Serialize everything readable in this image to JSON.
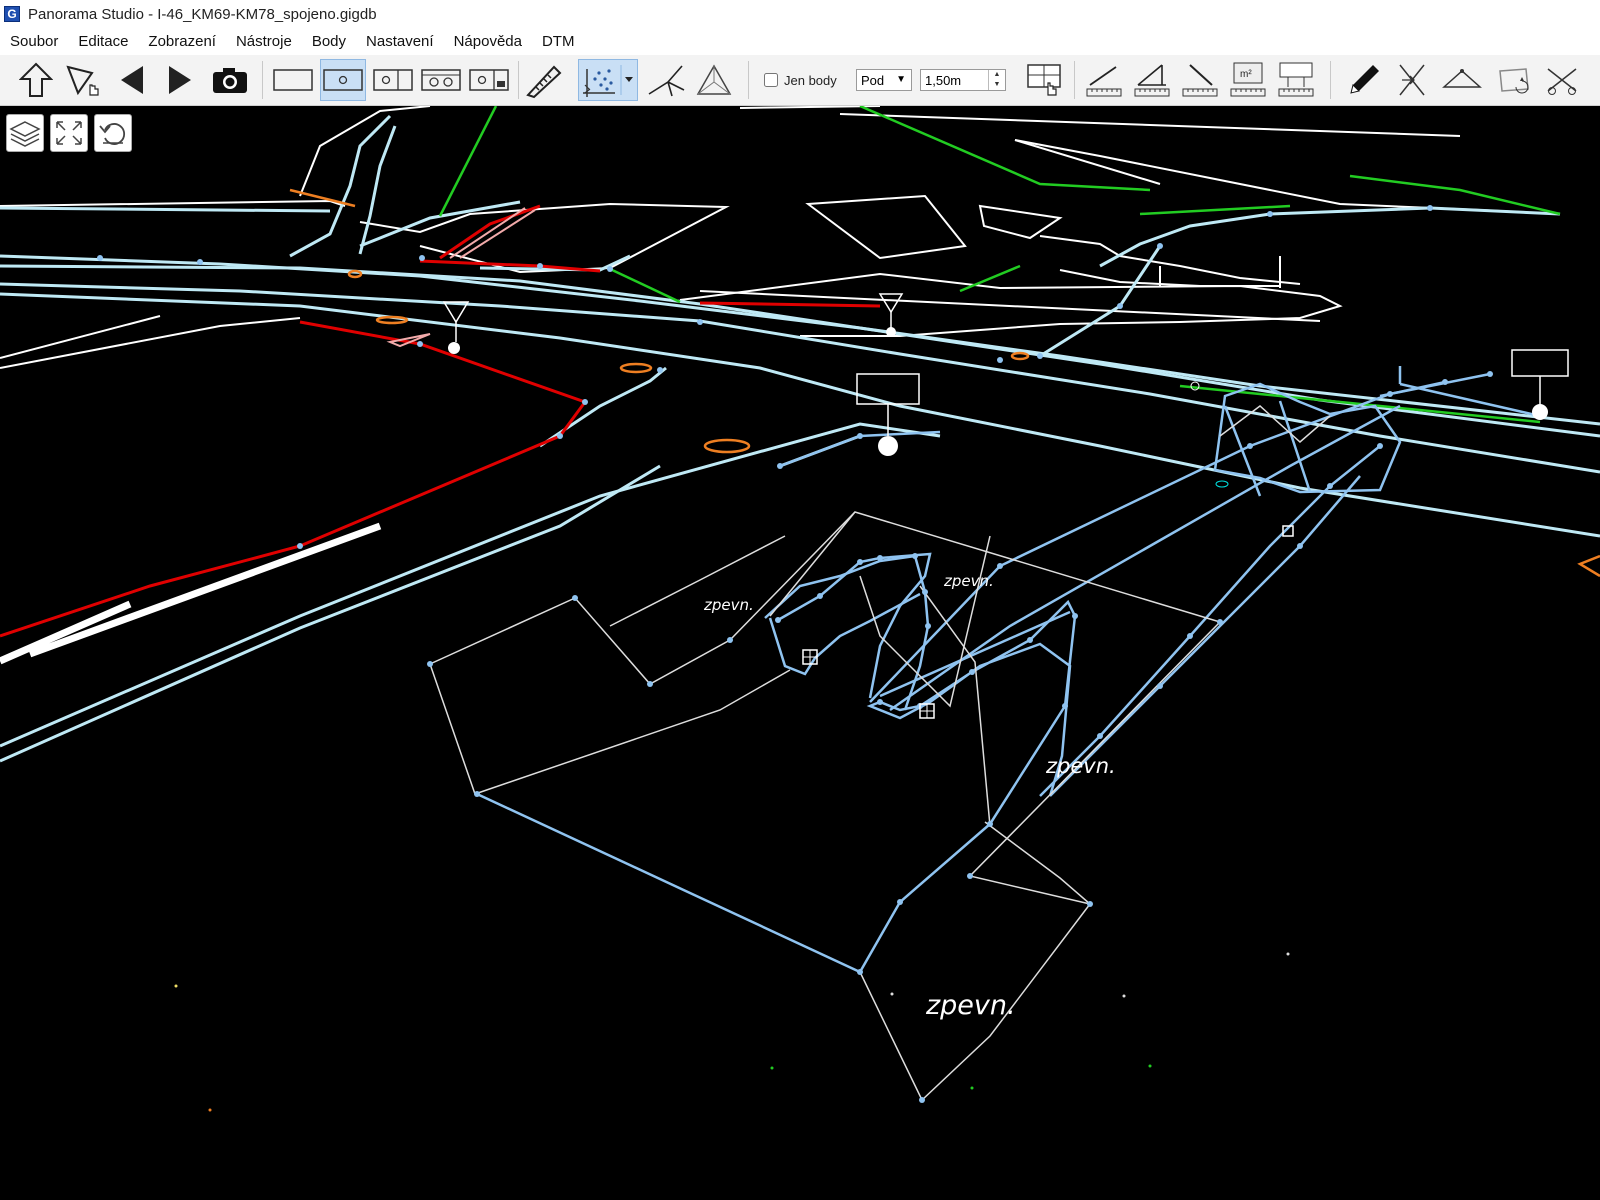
{
  "window": {
    "title": "Panorama Studio - I-46_KM69-KM78_spojeno.gigdb",
    "app_icon_letter": "G"
  },
  "menu": [
    "Soubor",
    "Editace",
    "Zobrazení",
    "Nástroje",
    "Body",
    "Nastavení",
    "Nápověda",
    "DTM"
  ],
  "toolbar": {
    "only_points_label": "Jen body",
    "only_points_checked": false,
    "position_select": "Pod",
    "height_value": "1,50m",
    "icons": [
      "arrow-up-icon",
      "select-cursor-icon",
      "previous-icon",
      "next-icon",
      "camera-icon",
      "rect-single-icon",
      "rect-circle-icon",
      "rect-circle-split-icon",
      "rect-double-circle-icon",
      "rect-text-icon",
      "measure-pen-icon",
      "point-cloud-icon",
      "dropdown-arrow-icon",
      "line-vertex-icon",
      "triangle-points-icon",
      "grid-cursor-icon",
      "measure-line-icon",
      "measure-angle-icon",
      "measure-slope-icon",
      "measure-area-icon",
      "measure-board-icon",
      "pencil-icon",
      "split-lines-icon",
      "triangle-line-icon",
      "move-rectangle-icon",
      "cut-lines-icon"
    ]
  },
  "viewport": {
    "buttons": [
      "layers-icon",
      "fit-extent-icon",
      "undo-view-icon"
    ],
    "labels": [
      {
        "text": "zpevn.",
        "size": "small"
      },
      {
        "text": "zpevn.",
        "size": "small"
      },
      {
        "text": "zpevn.",
        "size": "medium"
      },
      {
        "text": "zpevn.",
        "size": "large"
      }
    ]
  },
  "colors": {
    "background": "#000000",
    "line_blue": "#8fc3f0",
    "line_cyan": "#bfe9f5",
    "line_white": "#ffffff",
    "line_red": "#e00000",
    "line_green": "#22cc22",
    "line_orange": "#ee7f22",
    "line_pink": "#f2aaaa",
    "active_tool_bg": "#c9dff5"
  }
}
